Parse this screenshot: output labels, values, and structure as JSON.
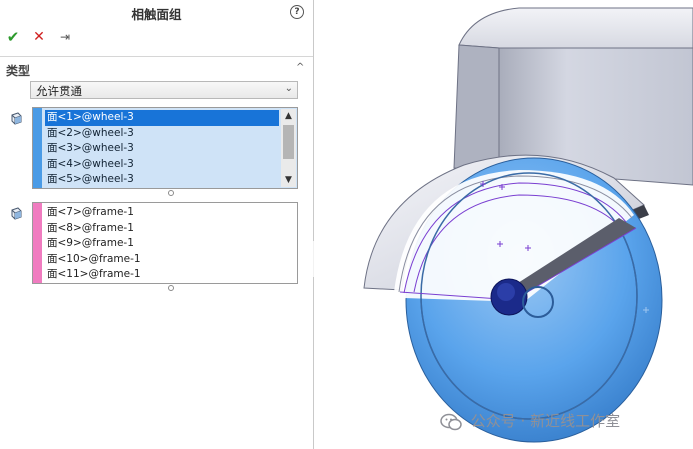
{
  "panel": {
    "title": "相触面组",
    "help_icon": "?",
    "toolbar": {
      "ok_icon": "✔",
      "cancel_icon": "✕",
      "pin_icon": "⇥"
    },
    "section": {
      "title": "类型",
      "collapse_icon": "^"
    },
    "type_select": {
      "value": "允许贯通",
      "arrow": "⌄"
    },
    "wheel_faces": {
      "items": [
        "面<1>@wheel-3",
        "面<2>@wheel-3",
        "面<3>@wheel-3",
        "面<4>@wheel-3",
        "面<5>@wheel-3"
      ],
      "selected_index": 0,
      "color": "#4a9be6"
    },
    "frame_faces": {
      "items": [
        "面<7>@frame-1",
        "面<8>@frame-1",
        "面<9>@frame-1",
        "面<10>@frame-1",
        "面<11>@frame-1"
      ],
      "color": "#f07cc0"
    }
  },
  "watermark": {
    "text": "公众号 · 新近线工作室",
    "icon": "wechat-icon"
  },
  "colors": {
    "selection": "#1874d8",
    "wheel_highlight": "#4f9ee8",
    "part_gray": "#c8ccd8"
  }
}
